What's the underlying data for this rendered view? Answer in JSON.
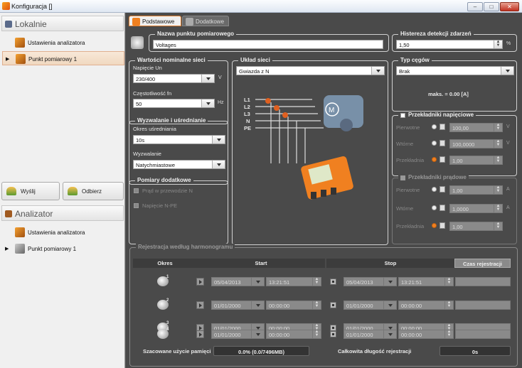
{
  "window": {
    "title": "Konfiguracja []"
  },
  "left": {
    "local_header": "Lokalnie",
    "local_items": [
      {
        "label": "Ustawienia analizatora"
      },
      {
        "label": "Punkt pomiarowy 1"
      }
    ],
    "send_button": "Wyślij",
    "receive_button": "Odbierz",
    "analyzer_header": "Analizator",
    "analyzer_items": [
      {
        "label": "Ustawienia analizatora"
      },
      {
        "label": "Punkt pomiarowy 1"
      }
    ]
  },
  "tabs": [
    {
      "label": "Podstawowe"
    },
    {
      "label": "Dodatkowe"
    }
  ],
  "point": {
    "legend": "Nazwa punktu pomiarowego",
    "value": "Voltages"
  },
  "hysteresis": {
    "legend": "Histereza detekcji zdarzeń",
    "value": "1,50",
    "unit": "%"
  },
  "nominal": {
    "legend": "Wartości nominalne sieci",
    "voltage_label": "Napięcie Un",
    "voltage_value": "230/400",
    "voltage_unit": "V",
    "freq_label": "Częstotliwość fn",
    "freq_value": "50",
    "freq_unit": "Hz"
  },
  "network": {
    "legend": "Układ sieci",
    "value": "Gwiazda z N",
    "phases": [
      "L1",
      "L2",
      "L3",
      "N",
      "PE"
    ]
  },
  "clamps": {
    "legend": "Typ cęgów",
    "value": "Brak",
    "max_text": "maks. =   0.00 [A]"
  },
  "trigger": {
    "legend": "Wyzwalanie i uśrednianie",
    "avg_label": "Okres uśredniania",
    "avg_value": "10s",
    "trig_label": "Wyzwalanie",
    "trig_value": "Natychmiastowe"
  },
  "vt": {
    "legend": "Przekładniki napięciowe",
    "rows": [
      {
        "label": "Pierwotne",
        "value": "100,00",
        "unit": "V"
      },
      {
        "label": "Wtórne",
        "value": "100,0000",
        "unit": "V"
      },
      {
        "label": "Przekładnia",
        "value": "1,00",
        "unit": ""
      }
    ]
  },
  "ct": {
    "legend": "Przekładniki prądowe",
    "rows": [
      {
        "label": "Pierwotne",
        "value": "1,00",
        "unit": "A"
      },
      {
        "label": "Wtórne",
        "value": "1,0000",
        "unit": "A"
      },
      {
        "label": "Przekładnia",
        "value": "1,00",
        "unit": ""
      }
    ]
  },
  "extra": {
    "legend": "Pomiary dodatkowe",
    "item1": "Prąd w przewodzie N",
    "item2": "Napięcie N-PE"
  },
  "schedule": {
    "legend": "Rejestracja według harmonogramu",
    "col_period": "Okres",
    "col_start": "Start",
    "col_stop": "Stop",
    "btn_time": "Czas rejestracji",
    "rows": [
      {
        "idx": "1",
        "start_date": "05/04/2013",
        "start_time": "13:21:51",
        "stop_date": "05/04/2013",
        "stop_time": "13:21:51"
      },
      {
        "idx": "2",
        "start_date": "01/01/2000",
        "start_time": "00:00:00",
        "stop_date": "01/01/2000",
        "stop_time": "00:00:00"
      },
      {
        "idx": "3",
        "start_date": "01/01/2000",
        "start_time": "00:00:00",
        "stop_date": "01/01/2000",
        "stop_time": "00:00:00"
      },
      {
        "idx": "4",
        "start_date": "01/01/2000",
        "start_time": "00:00:00",
        "stop_date": "01/01/2000",
        "stop_time": "00:00:00"
      }
    ],
    "mem_label": "Szacowane użycie pamięci",
    "mem_value": "0.0% (0.0/7496MB)",
    "total_label": "Całkowita długość rejestracji",
    "total_value": "0s"
  },
  "colors": {
    "accent": "#f08020",
    "bg": "#4a4a4a"
  }
}
